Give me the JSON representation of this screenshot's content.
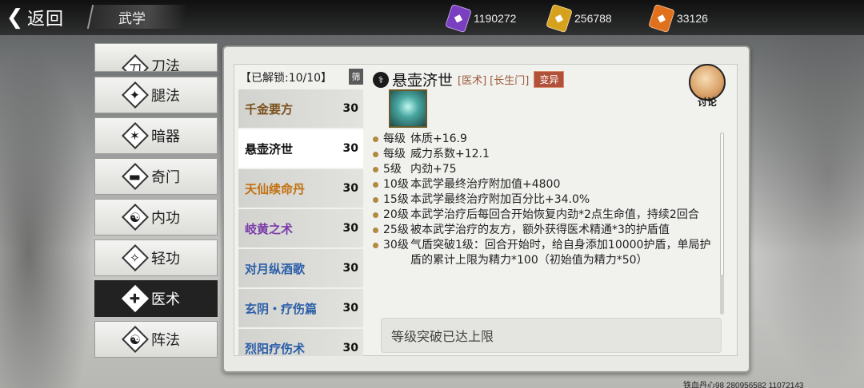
{
  "header": {
    "back_label": "返回",
    "title": "武学"
  },
  "currencies": [
    {
      "icon": "purple-token-icon",
      "amount": "1190272",
      "color": "#7a3fc0"
    },
    {
      "icon": "gold-token-icon",
      "amount": "256788",
      "color": "#d6a21e"
    },
    {
      "icon": "orange-token-icon",
      "amount": "33126",
      "color": "#e0701c"
    }
  ],
  "sidebar": {
    "items": [
      {
        "label": "刀法",
        "icon": "blade-icon"
      },
      {
        "label": "腿法",
        "icon": "kick-icon"
      },
      {
        "label": "暗器",
        "icon": "shuriken-icon"
      },
      {
        "label": "奇门",
        "icon": "ruler-icon"
      },
      {
        "label": "内功",
        "icon": "meditation-icon"
      },
      {
        "label": "轻功",
        "icon": "feather-icon"
      },
      {
        "label": "医术",
        "icon": "heal-icon",
        "active": true
      },
      {
        "label": "阵法",
        "icon": "taiji-icon"
      }
    ]
  },
  "list": {
    "unlocked_label": "【已解锁:10/10】",
    "filter_label": "筛",
    "items": [
      {
        "name": "千金要方",
        "level": "30",
        "color": "#7a4f1a"
      },
      {
        "name": "悬壶济世",
        "level": "30",
        "color": "#111111",
        "selected": true
      },
      {
        "name": "天仙续命丹",
        "level": "30",
        "color": "#c27010"
      },
      {
        "name": "岐黄之术",
        "level": "30",
        "color": "#7a3aa8"
      },
      {
        "name": "对月纵酒歌",
        "level": "30",
        "color": "#2a5ea8"
      },
      {
        "name": "玄阴・疗伤篇",
        "level": "30",
        "color": "#2a5ea8"
      },
      {
        "name": "烈阳疗伤术",
        "level": "30",
        "color": "#2a5ea8"
      }
    ]
  },
  "detail": {
    "name": "悬壶济世",
    "tag_type": "[医术]",
    "tag_school": "[长生门]",
    "variant_label": "变异",
    "discuss_label": "讨论",
    "effects": [
      {
        "level": "每级",
        "text": "体质+16.9"
      },
      {
        "level": "每级",
        "text": "威力系数+12.1"
      },
      {
        "level": "5级",
        "text": "内劲+75"
      },
      {
        "level": "10级",
        "text": "本武学最终治疗附加值+4800"
      },
      {
        "level": "15级",
        "text": "本武学最终治疗附加百分比+34.0%"
      },
      {
        "level": "20级",
        "text": "本武学治疗后每回合开始恢复内劲*2点生命值，持续2回合"
      },
      {
        "level": "25级",
        "text": "被本武学治疗的友方，额外获得医术精通*3的护盾值"
      },
      {
        "level": "30级",
        "text": "气盾突破1级：回合开始时，给自身添加10000护盾，单局护盾的累计上限为精力*100（初始值为精力*50）"
      }
    ],
    "breakthrough_text": "等级突破已达上限"
  },
  "watermark": "铁血丹心98 280956582 11072143"
}
